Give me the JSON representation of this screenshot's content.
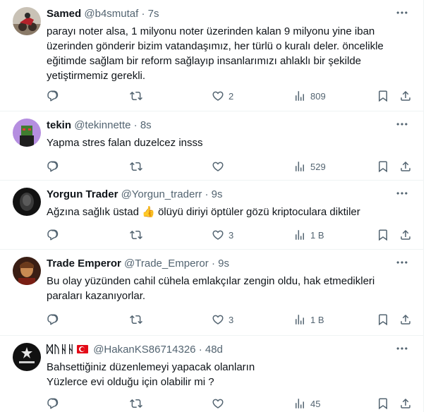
{
  "tweets": [
    {
      "name": "Samed",
      "handle": "@b4smutaf",
      "sep": "·",
      "time": "7s",
      "text": "parayı noter alsa, 1 milyonu noter üzerinden kalan 9 milyonu yine iban üzerinden gönderir bizim vatandaşımız, her türlü o kuralı deler. öncelikle eğitimde sağlam bir reform sağlayıp insanlarımızı ahlaklı bir şekilde yetiştirmemiz gerekli.",
      "likes": "2",
      "views": "809"
    },
    {
      "name": "tekin",
      "handle": "@tekinnette",
      "sep": "·",
      "time": "8s",
      "text": "Yapma stres falan duzelcez insss",
      "likes": "",
      "views": "529"
    },
    {
      "name": "Yorgun Trader",
      "handle": "@Yorgun_traderr",
      "sep": "·",
      "time": "9s",
      "text_before": "Ağzına sağlık üstad ",
      "emoji": "👍",
      "text_after": " ölüyü diriyi öptüler gözü kriptoculara diktiler",
      "likes": "3",
      "views": "1 B"
    },
    {
      "name": "Trade Emperor",
      "handle": "@Trade_Emperor",
      "sep": "·",
      "time": "9s",
      "text": "Bu olay yüzünden cahil cühela emlakçılar zengin oldu, hak etmedikleri paraları kazanıyorlar.",
      "likes": "3",
      "views": "1 B"
    },
    {
      "name": "ᛞᚢᚺᚺ",
      "handle": "@HakanKS86714326",
      "sep": "·",
      "time": "48d",
      "text_line1": "Bahsettiğiniz düzenlemeyi yapacak olanların",
      "text_line2": "Yüzlerce evi olduğu için olabilir mi ?",
      "likes": "",
      "views": "45"
    }
  ],
  "icons": {
    "reply": "reply-icon",
    "retweet": "retweet-icon",
    "like": "heart-icon",
    "views": "views-icon",
    "bookmark": "bookmark-icon",
    "share": "share-icon",
    "more": "more-icon"
  }
}
